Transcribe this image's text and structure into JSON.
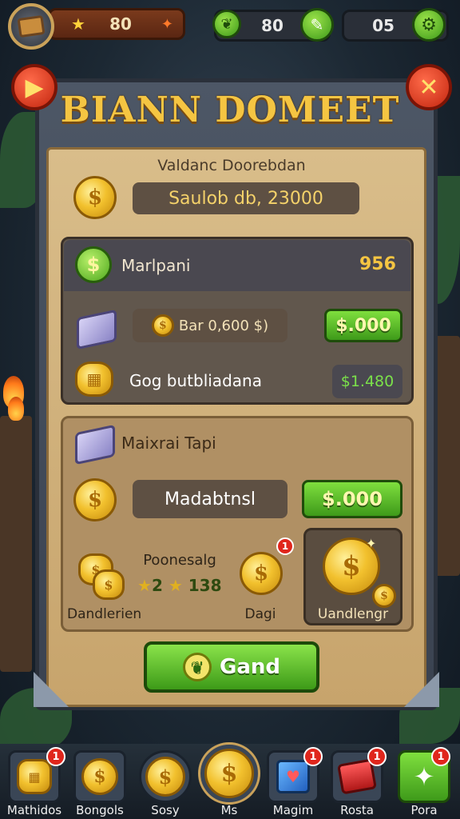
{
  "hud": {
    "coins": "80",
    "gems": "80",
    "gear": "05"
  },
  "title": "BIANN DOMEET",
  "panel": {
    "subtitle": "Valdanc Doorebdan",
    "balance": "Saulob db, 23000",
    "section1": {
      "header_label": "Marlpani",
      "header_value": "956",
      "row1_text": "Bar 0,600 $)",
      "row1_button": "$.000",
      "row2_text": "Gog butbliadana",
      "row2_value": "$1.480"
    },
    "section2": {
      "header_label": "Maixrai Tapi",
      "field_text": "Madabtnsl",
      "button": "$.000",
      "bonus_label": "Poonesalg",
      "bonus_stars": "2",
      "bonus_value": "138",
      "item1_label": "Dandlerien",
      "item2_label": "Dagi",
      "item2_badge": "1",
      "item3_label": "Uandlengr"
    },
    "cta": "Gand"
  },
  "nav": [
    {
      "label": "Mathidos",
      "badge": "1",
      "icon": "coin-stack-icon"
    },
    {
      "label": "Bongols",
      "badge": "",
      "icon": "coin-icon"
    },
    {
      "label": "Sosy",
      "badge": "",
      "icon": "coin-icon"
    },
    {
      "label": "Ms",
      "badge": "",
      "icon": "big-coin-icon"
    },
    {
      "label": "Magim",
      "badge": "1",
      "icon": "gift-box-icon"
    },
    {
      "label": "Rosta",
      "badge": "1",
      "icon": "red-chest-icon"
    },
    {
      "label": "Pora",
      "badge": "1",
      "icon": "star-icon"
    }
  ],
  "colors": {
    "accent_gold": "#f5c542",
    "button_green": "#3e9a1a",
    "close_red": "#c3260f"
  }
}
